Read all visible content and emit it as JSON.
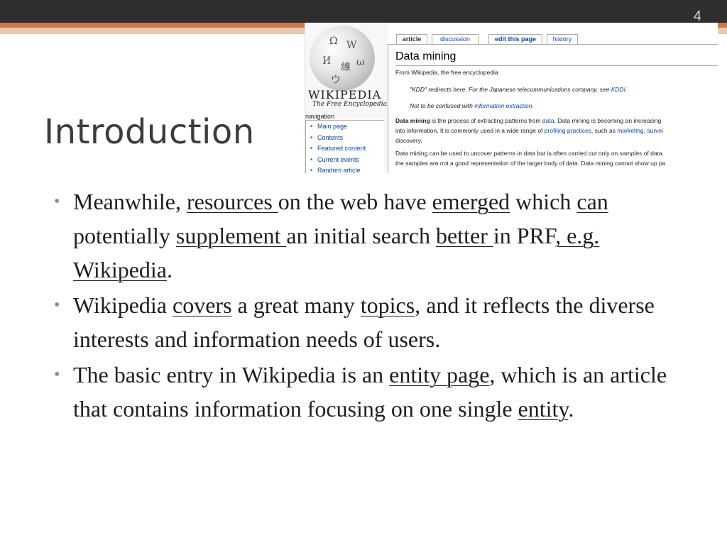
{
  "slide": {
    "number": "4",
    "title": "Introduction"
  },
  "wikipedia": {
    "wordmark": "WIKIPEDIA",
    "tagline": "The Free Encyclopedia",
    "globe_glyphs": [
      "Ω",
      "W",
      "И",
      "維",
      "ω",
      "ウ"
    ],
    "nav_heading": "navigation",
    "nav_items": [
      "Main page",
      "Contents",
      "Featured content",
      "Current events",
      "Random article"
    ],
    "tabs": {
      "article": "article",
      "discussion": "discussion",
      "edit": "edit this page",
      "history": "history"
    },
    "page_title": "Data mining",
    "from_line": "From Wikipedia, the free encyclopedia",
    "redirect_note": {
      "pre": "\"KDD\" redirects here. For the Japanese telecommunications company, see ",
      "link": "KDDI",
      "post": "."
    },
    "confused_note": {
      "pre": "Not to be confused with ",
      "link": "information extraction",
      "post": "."
    },
    "para1": {
      "bold": "Data mining",
      "t1": " is the process of extracting patterns from ",
      "l1": "data",
      "t2": ". Data mining is becoming an increasing",
      "t3": "into information. It is commonly used in a wide range of ",
      "l2": "profiling practices",
      "t4": ", such as ",
      "l3": "marketing",
      "t5": ", ",
      "l4": "survei",
      "t6": "discovery."
    },
    "para2": {
      "line1_pre": "Data mining can be used to uncover patterns in data but is often carried out only on ",
      "line1_italic": "samples",
      "line1_post": " of data.",
      "line2": "the samples are not a good representation of the larger body of data. Data mining cannot show up pa"
    }
  },
  "bullets": [
    {
      "parts": [
        {
          "t": "Meanwhile, ",
          "u": false
        },
        {
          "t": "resources ",
          "u": true
        },
        {
          "t": "on the web have ",
          "u": false
        },
        {
          "t": "emerged",
          "u": true
        },
        {
          "t": " which ",
          "u": false
        },
        {
          "t": "can",
          "u": true
        },
        {
          "t": " potentially ",
          "u": false
        },
        {
          "t": "supplement ",
          "u": true
        },
        {
          "t": "an initial search ",
          "u": false
        },
        {
          "t": "better ",
          "u": true
        },
        {
          "t": "in PRF",
          "u": false
        },
        {
          "t": ", e.g. Wikipedia",
          "u": true
        },
        {
          "t": ".",
          "u": false
        }
      ]
    },
    {
      "parts": [
        {
          "t": "Wikipedia ",
          "u": false
        },
        {
          "t": "covers",
          "u": true
        },
        {
          "t": " a great many ",
          "u": false
        },
        {
          "t": "topics",
          "u": true
        },
        {
          "t": ", and it reflects the diverse interests and information needs of users.",
          "u": false
        }
      ]
    },
    {
      "parts": [
        {
          "t": "The basic entry in Wikipedia is an ",
          "u": false
        },
        {
          "t": "entity page",
          "u": true
        },
        {
          "t": ", which is an article that contains information focusing on one single ",
          "u": false
        },
        {
          "t": "entity",
          "u": true
        },
        {
          "t": ".",
          "u": false
        }
      ]
    }
  ]
}
